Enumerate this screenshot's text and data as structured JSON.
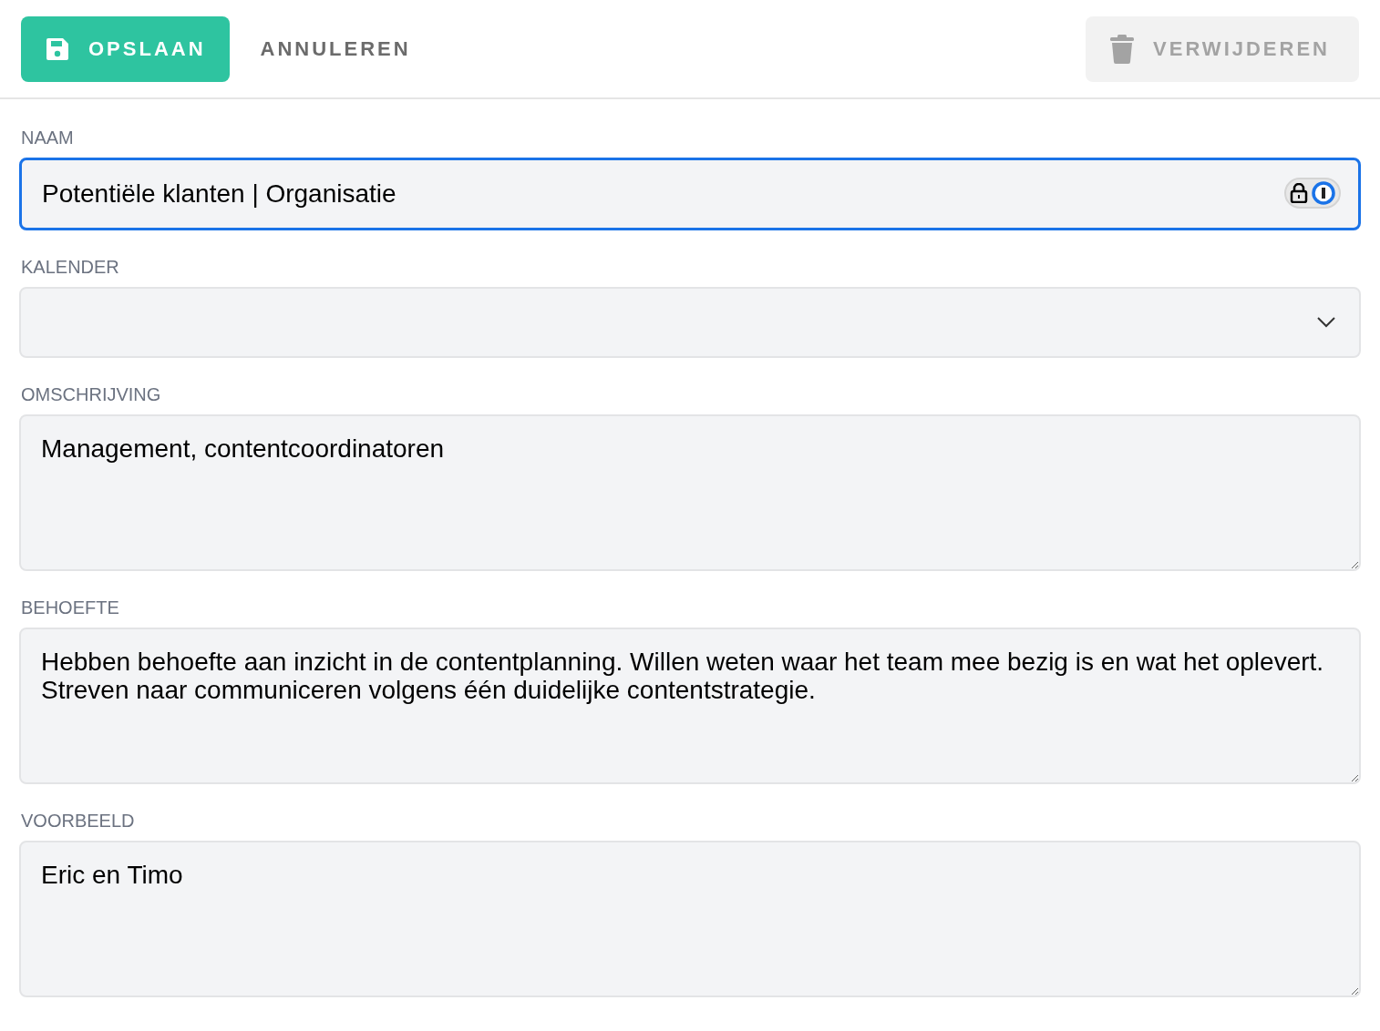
{
  "toolbar": {
    "buttons": [
      {
        "kind": "save",
        "label": "OPSLAAN",
        "disabled": false
      },
      {
        "kind": "cancel",
        "label": "ANNULEREN",
        "disabled": false
      },
      {
        "kind": "delete",
        "label": "VERWIJDEREN",
        "disabled": true
      }
    ]
  },
  "fields": [
    {
      "kind": "input",
      "label": "NAAM",
      "value": "Potentiële klanten | Organisatie",
      "focused": true
    },
    {
      "kind": "select",
      "label": "KALENDER",
      "focused": false
    },
    {
      "kind": "textarea",
      "label": "OMSCHRIJVING",
      "value": "Management, contentcoordinatoren",
      "focused": false
    },
    {
      "kind": "textarea",
      "label": "BEHOEFTE",
      "value": "Hebben behoefte aan inzicht in de contentplanning. Willen weten waar het team mee bezig is en wat het oplevert. Streven naar communiceren volgens één duidelijke contentstrategie.",
      "focused": false
    },
    {
      "kind": "textarea",
      "label": "VOORBEELD",
      "value": "Eric en Timo",
      "focused": false
    }
  ]
}
